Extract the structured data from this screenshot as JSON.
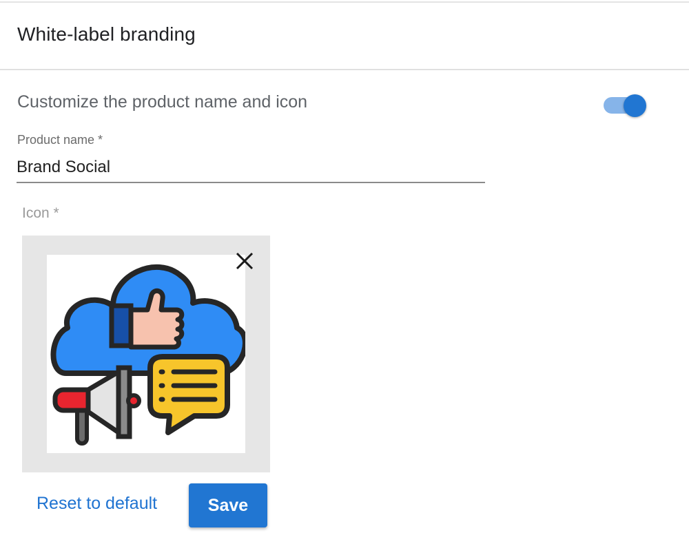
{
  "header": {
    "title": "White-label branding"
  },
  "branding": {
    "toggle_label": "Customize the product name and icon",
    "toggle_on": true,
    "product_name": {
      "label": "Product name *",
      "value": "Brand Social"
    },
    "icon": {
      "label": "Icon *",
      "image": "cloud-thumbs-up-megaphone-chat-icon"
    }
  },
  "actions": {
    "reset_label": "Reset to default",
    "save_label": "Save"
  },
  "colors": {
    "accent": "#2176d2",
    "toggle_track": "#86b4e9",
    "link": "#1f73d1",
    "cloud": "#2f8cf5",
    "chat": "#f7c52b",
    "megaphone_red": "#e8252f"
  }
}
